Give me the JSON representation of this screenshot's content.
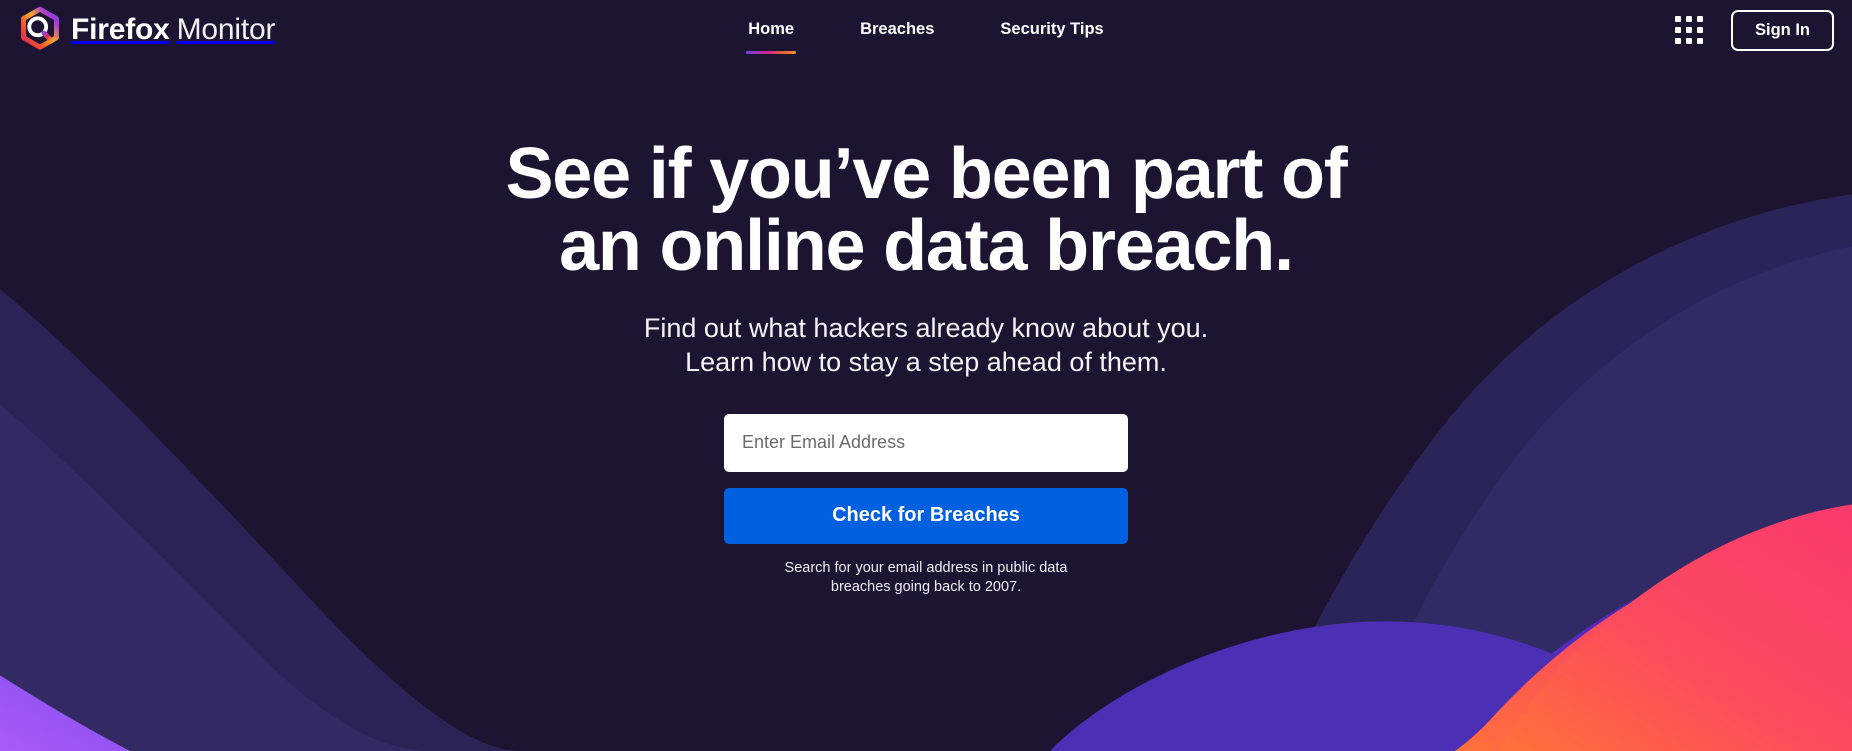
{
  "brand": {
    "logo_icon": "firefox-monitor-hexagon-magnifier-logo",
    "name_bold": "Firefox",
    "name_light": "Monitor"
  },
  "nav": {
    "items": [
      {
        "label": "Home",
        "active": true
      },
      {
        "label": "Breaches",
        "active": false
      },
      {
        "label": "Security Tips",
        "active": false
      }
    ]
  },
  "header_right": {
    "apps_icon": "apps-grid-icon",
    "sign_in_label": "Sign In"
  },
  "hero": {
    "headline_line1": "See if you’ve been part of",
    "headline_line2": "an online data breach.",
    "subhead_line1": "Find out what hackers already know about you.",
    "subhead_line2": "Learn how to stay a step ahead of them.",
    "email_placeholder": "Enter Email Address",
    "email_value": "",
    "cta_label": "Check for Breaches",
    "fineprint_line1": "Search for your email address in public data",
    "fineprint_line2": "breaches going back to 2007."
  },
  "colors": {
    "background": "#1d1431",
    "cta_blue": "#0060df",
    "accent_gradient_start": "#7542e5",
    "accent_gradient_mid": "#d6228f",
    "accent_gradient_end": "#f0902a",
    "blob_navy": "#2a2459",
    "blob_indigo": "#322a66",
    "blob_violet": "#4b2fb5",
    "blob_purple_bright": "#9a57f5",
    "blob_pink": "#f9386f",
    "blob_orange": "#ff7139",
    "text_primary": "#ffffff",
    "placeholder": "#6c6a70"
  }
}
